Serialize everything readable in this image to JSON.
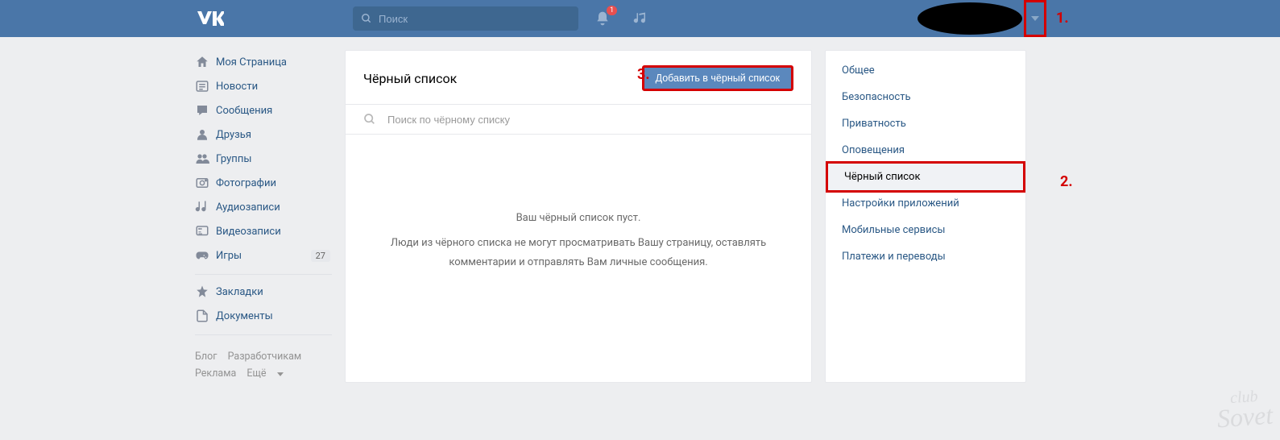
{
  "header": {
    "search_placeholder": "Поиск",
    "notification_count": "1"
  },
  "annotations": {
    "a1": "1.",
    "a2": "2.",
    "a3": "3."
  },
  "sidebar": {
    "items": [
      {
        "label": "Моя Страница"
      },
      {
        "label": "Новости"
      },
      {
        "label": "Сообщения"
      },
      {
        "label": "Друзья"
      },
      {
        "label": "Группы"
      },
      {
        "label": "Фотографии"
      },
      {
        "label": "Аудиозаписи"
      },
      {
        "label": "Видеозаписи"
      },
      {
        "label": "Игры",
        "count": "27"
      }
    ],
    "items2": [
      {
        "label": "Закладки"
      },
      {
        "label": "Документы"
      }
    ]
  },
  "footer": {
    "blog": "Блог",
    "dev": "Разработчикам",
    "ads": "Реклама",
    "more": "Ещё"
  },
  "main": {
    "title": "Чёрный список",
    "add_button": "Добавить в чёрный список",
    "search_placeholder": "Поиск по чёрному списку",
    "empty_title": "Ваш чёрный список пуст.",
    "empty_text": "Люди из чёрного списка не могут просматривать Вашу страницу, оставлять комментарии и отправлять Вам личные сообщения."
  },
  "settings": {
    "items": [
      "Общее",
      "Безопасность",
      "Приватность",
      "Оповещения",
      "Чёрный список",
      "Настройки приложений",
      "Мобильные сервисы",
      "Платежи и переводы"
    ],
    "active_index": 4
  },
  "watermark": {
    "top": "club",
    "bottom": "Sovet"
  }
}
